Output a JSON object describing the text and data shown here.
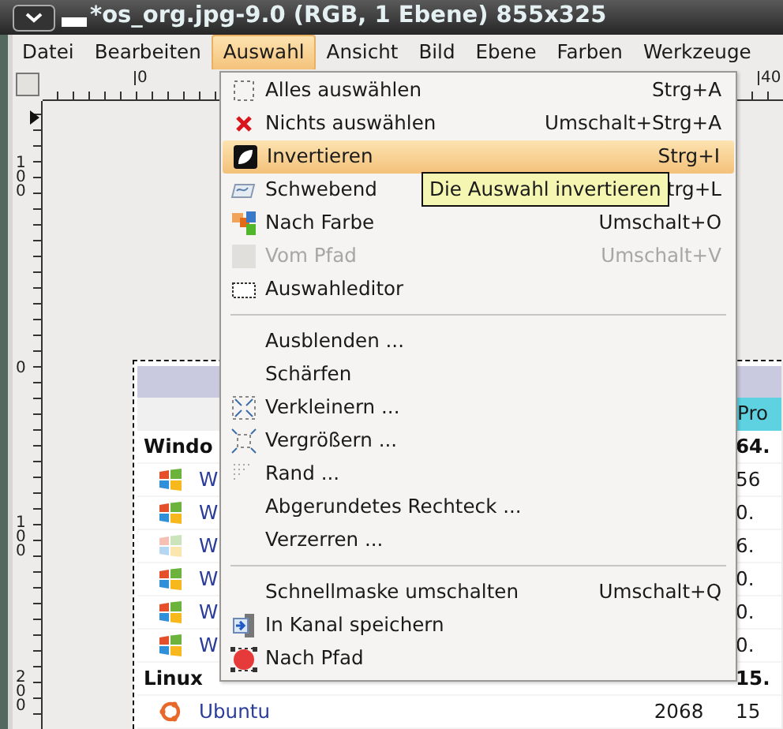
{
  "window": {
    "title": "*os_org.jpg-9.0 (RGB, 1 Ebene) 855x325"
  },
  "menubar": [
    {
      "label": "Datei",
      "selected": false
    },
    {
      "label": "Bearbeiten",
      "selected": false
    },
    {
      "label": "Auswahl",
      "selected": true
    },
    {
      "label": "Ansicht",
      "selected": false
    },
    {
      "label": "Bild",
      "selected": false
    },
    {
      "label": "Ebene",
      "selected": false
    },
    {
      "label": "Farben",
      "selected": false
    },
    {
      "label": "Werkzeuge",
      "selected": false
    }
  ],
  "rulers": {
    "horizontal": [
      "0",
      "40"
    ],
    "vertical": [
      "100",
      "0",
      "100",
      "200"
    ]
  },
  "image_table": {
    "header": "Pro",
    "rows": [
      {
        "kind": "group",
        "name": "Windo",
        "value": "64."
      },
      {
        "kind": "windows",
        "name": "W",
        "value": "56"
      },
      {
        "kind": "windows",
        "name": "W",
        "value": "0."
      },
      {
        "kind": "windows-faded",
        "name": "W",
        "value": "6."
      },
      {
        "kind": "windows",
        "name": "W",
        "value": "0."
      },
      {
        "kind": "windows",
        "name": "W",
        "value": "0."
      },
      {
        "kind": "windows",
        "name": "W",
        "value": "0."
      },
      {
        "kind": "group",
        "name": "Linux",
        "value": "15."
      },
      {
        "kind": "linux",
        "name": "Ubuntu",
        "year": "2068",
        "value": "15"
      }
    ]
  },
  "menu": [
    {
      "kind": "item",
      "label": "Alles auswählen",
      "shortcut": "Strg+A",
      "selected": false,
      "disabled": false
    },
    {
      "kind": "item",
      "label": "Nichts auswählen",
      "shortcut": "Umschalt+Strg+A",
      "selected": false,
      "disabled": false
    },
    {
      "kind": "item",
      "label": "Invertieren",
      "shortcut": "Strg+I",
      "selected": true,
      "disabled": false
    },
    {
      "kind": "item",
      "label": "Schwebend",
      "shortcut": "trg+L",
      "selected": false,
      "disabled": false
    },
    {
      "kind": "item",
      "label": "Nach Farbe",
      "shortcut": "Umschalt+O",
      "selected": false,
      "disabled": false
    },
    {
      "kind": "item",
      "label": "Vom Pfad",
      "shortcut": "Umschalt+V",
      "selected": false,
      "disabled": true
    },
    {
      "kind": "item",
      "label": "Auswahleditor",
      "selected": false,
      "disabled": false
    },
    {
      "kind": "separator"
    },
    {
      "kind": "item",
      "label": "Ausblenden ...",
      "selected": false,
      "disabled": false
    },
    {
      "kind": "item",
      "label": "Schärfen",
      "selected": false,
      "disabled": false
    },
    {
      "kind": "item",
      "label": "Verkleinern ...",
      "selected": false,
      "disabled": false
    },
    {
      "kind": "item",
      "label": "Vergrößern ...",
      "selected": false,
      "disabled": false
    },
    {
      "kind": "item",
      "label": "Rand ...",
      "selected": false,
      "disabled": false
    },
    {
      "kind": "item",
      "label": "Abgerundetes Rechteck ...",
      "selected": false,
      "disabled": false
    },
    {
      "kind": "item",
      "label": "Verzerren ...",
      "selected": false,
      "disabled": false
    },
    {
      "kind": "separator"
    },
    {
      "kind": "item",
      "label": "Schnellmaske umschalten",
      "shortcut": "Umschalt+Q",
      "selected": false,
      "disabled": false
    },
    {
      "kind": "item",
      "label": "In Kanal speichern",
      "selected": false,
      "disabled": false
    },
    {
      "kind": "item",
      "label": "Nach Pfad",
      "selected": false,
      "disabled": false
    }
  ],
  "tooltip": {
    "text": "Die Auswahl invertieren"
  }
}
